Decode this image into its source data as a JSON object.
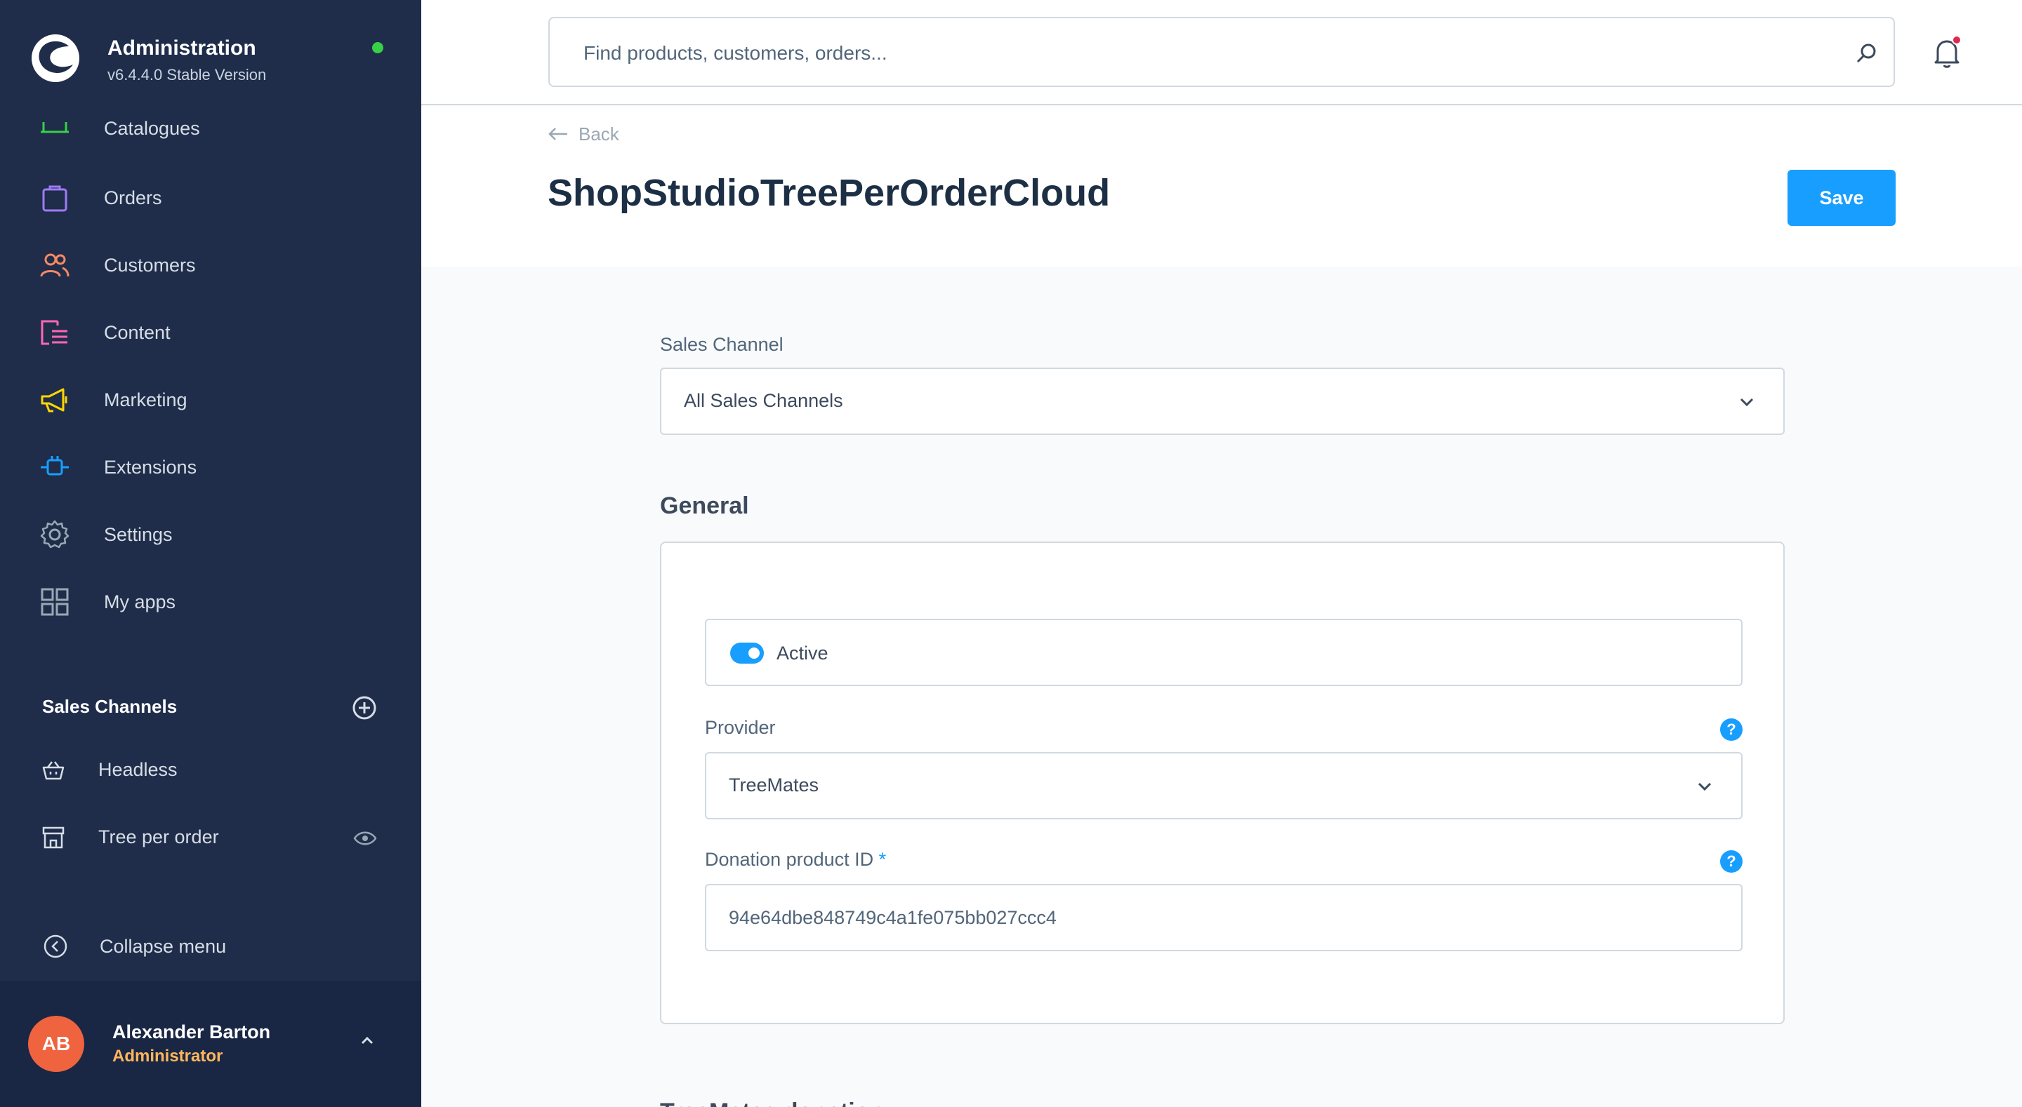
{
  "app": {
    "title": "Administration",
    "version": "v6.4.4.0 Stable Version"
  },
  "sidebar": {
    "items": [
      {
        "label": "Catalogues",
        "icon": "catalogues-icon"
      },
      {
        "label": "Orders",
        "icon": "orders-bag-icon"
      },
      {
        "label": "Customers",
        "icon": "customers-icon"
      },
      {
        "label": "Content",
        "icon": "content-icon"
      },
      {
        "label": "Marketing",
        "icon": "marketing-megaphone-icon"
      },
      {
        "label": "Extensions",
        "icon": "extensions-plug-icon"
      },
      {
        "label": "Settings",
        "icon": "settings-gear-icon"
      },
      {
        "label": "My apps",
        "icon": "my-apps-grid-icon"
      }
    ],
    "sales_channels": {
      "heading": "Sales Channels",
      "items": [
        {
          "label": "Headless",
          "icon": "basket-icon"
        },
        {
          "label": "Tree per order",
          "icon": "storefront-icon"
        }
      ]
    },
    "collapse_label": "Collapse menu",
    "user": {
      "initials": "AB",
      "name": "Alexander Barton",
      "role": "Administrator"
    }
  },
  "topbar": {
    "search_placeholder": "Find products, customers, orders..."
  },
  "page": {
    "back_label": "Back",
    "title": "ShopStudioTreePerOrderCloud",
    "save_label": "Save"
  },
  "form": {
    "sales_channel_label": "Sales Channel",
    "sales_channel_value": "All Sales Channels",
    "section_general": "General",
    "active_label": "Active",
    "active_on": true,
    "provider_label": "Provider",
    "provider_value": "TreeMates",
    "donation_label": "Donation product ID",
    "donation_required": "*",
    "donation_value": "94e64dbe848749c4a1fe075bb027ccc4",
    "help_glyph": "?",
    "next_section": "TreeMates donation"
  },
  "colors": {
    "sidebar_bg": "#1f2d4a",
    "accent": "#189eff",
    "status_online": "#37d046",
    "notification": "#de294c",
    "avatar": "#f0633f",
    "role": "#ffb75d"
  }
}
